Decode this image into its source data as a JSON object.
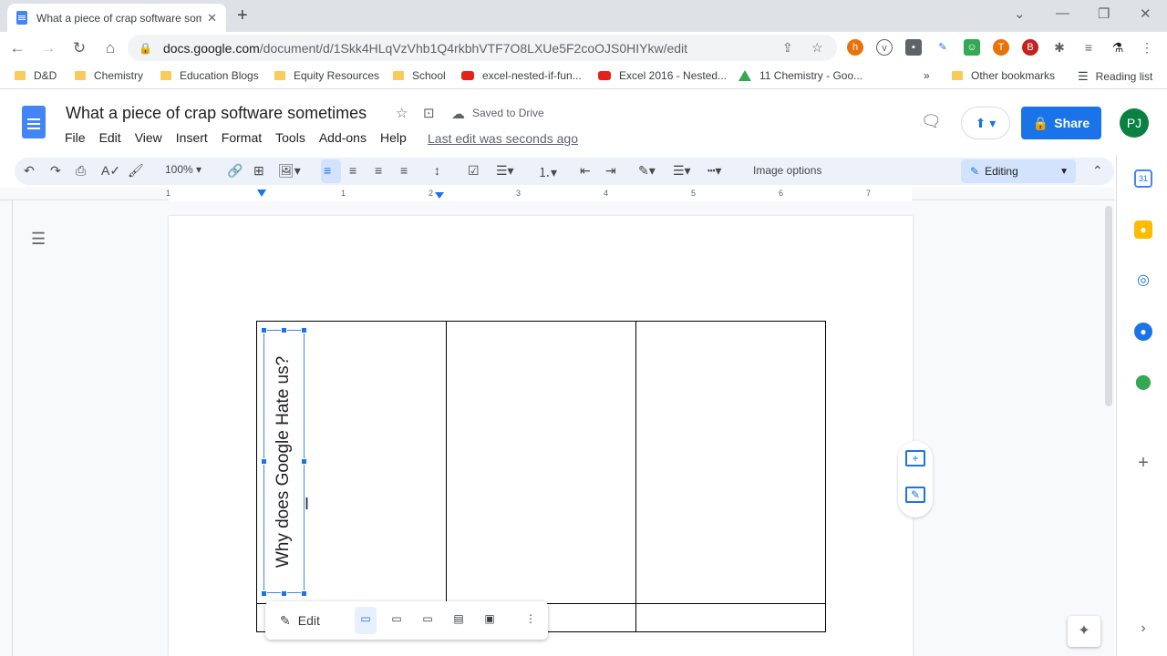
{
  "browser": {
    "tab_title": "What a piece of crap software sometimes",
    "url_domain": "docs.google.com",
    "url_path": "/document/d/1Skk4HLqVzVhb1Q4rkbhVTF7O8LXUe5F2coOJS0HIYkw/edit",
    "bookmarks": [
      {
        "label": "D&D",
        "icon": "folder"
      },
      {
        "label": "Chemistry",
        "icon": "folder"
      },
      {
        "label": "Education Blogs",
        "icon": "folder"
      },
      {
        "label": "Equity Resources",
        "icon": "folder"
      },
      {
        "label": "School",
        "icon": "folder"
      },
      {
        "label": "excel-nested-if-fun...",
        "icon": "youtube"
      },
      {
        "label": "Excel 2016 - Nested...",
        "icon": "youtube"
      },
      {
        "label": "11 Chemistry - Goo...",
        "icon": "drive"
      }
    ],
    "more_bookmarks": "»",
    "other_bookmarks": "Other bookmarks",
    "reading_list": "Reading list"
  },
  "doc": {
    "title": "What a piece of crap software sometimes",
    "saved_status": "Saved to Drive",
    "last_edit": "Last edit was seconds ago",
    "menu": [
      "File",
      "Edit",
      "View",
      "Insert",
      "Format",
      "Tools",
      "Add-ons",
      "Help"
    ],
    "share_label": "Share",
    "avatar_initials": "PJ"
  },
  "toolbar": {
    "zoom": "100%",
    "image_options": "Image options",
    "mode": "Editing"
  },
  "ruler": {
    "marks": [
      "1",
      "1",
      "2",
      "3",
      "4",
      "5",
      "6",
      "7"
    ]
  },
  "content": {
    "rotated_text": "Why does Google Hate us?"
  },
  "image_toolbar": {
    "edit_label": "Edit"
  },
  "side_panel": {
    "calendar_day": "31"
  },
  "colors": {
    "accent": "#1a73e8",
    "avatar": "#0b8043",
    "toolbar_bg": "#edf2fa"
  }
}
